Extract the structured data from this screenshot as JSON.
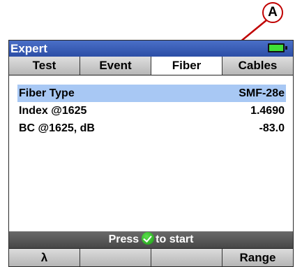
{
  "callout": {
    "label": "A"
  },
  "window": {
    "title": "Expert",
    "battery_color": "#3fe036"
  },
  "tabs": [
    {
      "label": "Test",
      "active": false
    },
    {
      "label": "Event",
      "active": false
    },
    {
      "label": "Fiber",
      "active": true
    },
    {
      "label": "Cables",
      "active": false
    }
  ],
  "fiber": {
    "rows": [
      {
        "label": "Fiber Type",
        "value": "SMF-28e",
        "selected": true
      },
      {
        "label": "Index @1625",
        "value": "1.4690",
        "selected": false
      },
      {
        "label": "BC @1625, dB",
        "value": "-83.0",
        "selected": false
      }
    ]
  },
  "status": {
    "prefix": "Press",
    "icon": "green-check-icon",
    "suffix": "to start"
  },
  "softkeys": [
    {
      "label": "λ"
    },
    {
      "label": ""
    },
    {
      "label": ""
    },
    {
      "label": "Range"
    }
  ],
  "colors": {
    "selection": "#a8c8f4",
    "titlebar": "#2c4ea6",
    "callout": "#c00000"
  }
}
